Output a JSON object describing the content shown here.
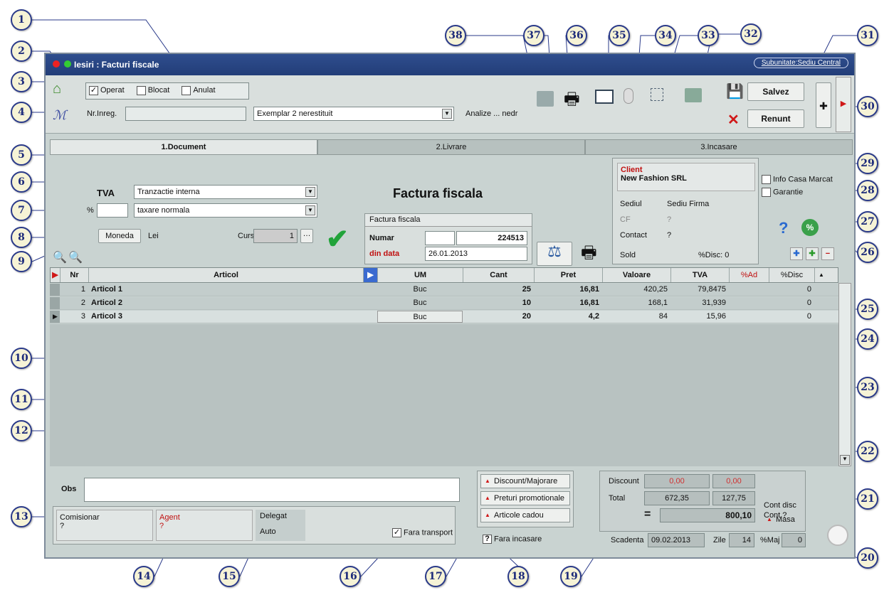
{
  "window": {
    "title": "Iesiri : Facturi fiscale",
    "subunit": "Subunitate:Sediu Central"
  },
  "status": {
    "operat": "Operat",
    "blocat": "Blocat",
    "anulat": "Anulat"
  },
  "reg": {
    "label": "Nr.Inreg."
  },
  "exemplar": "Exemplar 2 nerestituit",
  "analize": "Analize ... nedr",
  "actions": {
    "save": "Salvez",
    "cancel": "Renunt"
  },
  "tabs": [
    "1.Document",
    "2.Livrare",
    "3.Incasare"
  ],
  "tva": {
    "label": "TVA",
    "percent_label": "%",
    "transaction": "Tranzactie interna",
    "taxation": "taxare normala"
  },
  "moneda": {
    "button": "Moneda",
    "value": "Lei",
    "curs_label": "Curs",
    "curs": "1"
  },
  "doc": {
    "heading": "Factura fiscala",
    "type": "Factura fiscala",
    "numar_label": "Numar",
    "numar": "224513",
    "data_label": "din data",
    "data": "26.01.2013"
  },
  "client": {
    "label": "Client",
    "name": "New Fashion SRL",
    "sediu_label": "Sediul",
    "sediu": "Sediu Firma",
    "cf_label": "CF",
    "cf": "?",
    "contact_label": "Contact",
    "contact": "?",
    "sold_label": "Sold",
    "disc_label": "%Disc: 0"
  },
  "options": {
    "casa": "Info Casa Marcat",
    "garantie": "Garantie"
  },
  "grid": {
    "headers": [
      "Nr",
      "Articol",
      "UM",
      "Cant",
      "Pret",
      "Valoare",
      "TVA",
      "%Ad",
      "%Disc"
    ],
    "rows": [
      {
        "nr": "1",
        "articol": "Articol 1",
        "um": "Buc",
        "cant": "25",
        "pret": "16,81",
        "valoare": "420,25",
        "tva": "79,8475",
        "disc": "0"
      },
      {
        "nr": "2",
        "articol": "Articol 2",
        "um": "Buc",
        "cant": "10",
        "pret": "16,81",
        "valoare": "168,1",
        "tva": "31,939",
        "disc": "0"
      },
      {
        "nr": "3",
        "articol": "Articol 3",
        "um": "Buc",
        "cant": "20",
        "pret": "4,2",
        "valoare": "84",
        "tva": "15,96",
        "disc": "0"
      }
    ]
  },
  "obs": {
    "label": "Obs"
  },
  "bottom": {
    "comisionar": "Comisionar",
    "comisionar_val": "?",
    "agent": "Agent",
    "agent_val": "?",
    "delegat": "Delegat",
    "auto": "Auto",
    "fara_transport": "Fara transport"
  },
  "mid_buttons": {
    "discount": "Discount/Majorare",
    "promo": "Preturi promotionale",
    "cadou": "Articole cadou",
    "fara_incasare": "Fara incasare"
  },
  "totals": {
    "discount_label": "Discount",
    "discount_val": "0,00",
    "discount_tva": "0,00",
    "total_label": "Total",
    "total_val": "672,35",
    "total_tva": "127,75",
    "grand": "800,10",
    "cont_disc": "Cont disc",
    "cont": "Cont ?",
    "masa": "Masa",
    "scadenta_label": "Scadenta",
    "scadenta": "09.02.2013",
    "zile_label": "Zile",
    "zile": "14",
    "maj_label": "%Maj",
    "maj": "0"
  },
  "callouts": [
    "1",
    "2",
    "3",
    "4",
    "5",
    "6",
    "7",
    "8",
    "9",
    "10",
    "11",
    "12",
    "13",
    "14",
    "15",
    "16",
    "17",
    "18",
    "19",
    "20",
    "21",
    "22",
    "23",
    "24",
    "25",
    "26",
    "27",
    "28",
    "29",
    "30",
    "31",
    "32",
    "33",
    "34",
    "35",
    "36",
    "37",
    "38"
  ]
}
